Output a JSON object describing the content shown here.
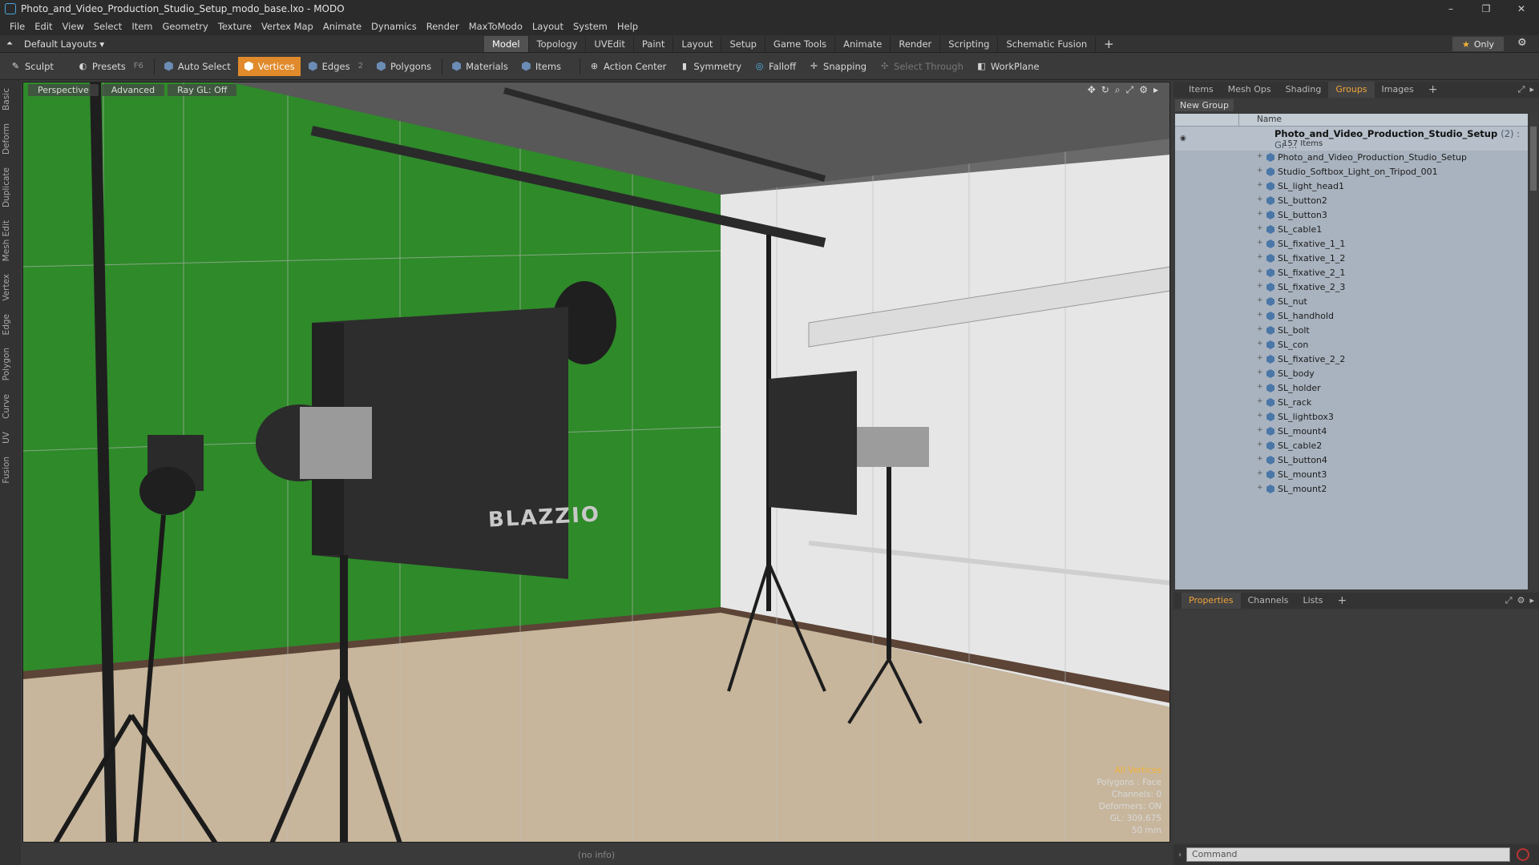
{
  "window": {
    "title": "Photo_and_Video_Production_Studio_Setup_modo_base.lxo - MODO",
    "controls": [
      "–",
      "❐",
      "✕"
    ]
  },
  "menu": [
    "File",
    "Edit",
    "View",
    "Select",
    "Item",
    "Geometry",
    "Texture",
    "Vertex Map",
    "Animate",
    "Dynamics",
    "Render",
    "MaxToModo",
    "Layout",
    "System",
    "Help"
  ],
  "layoutbar": {
    "layout_select": "Default Layouts ▾",
    "tabs": [
      "Model",
      "Topology",
      "UVEdit",
      "Paint",
      "Layout",
      "Setup",
      "Game Tools",
      "Animate",
      "Render",
      "Scripting",
      "Schematic Fusion"
    ],
    "active_tab": "Model",
    "only_label": "Only"
  },
  "toolbar": {
    "sculpt": "Sculpt",
    "presets": "Presets",
    "presets_key": "F6",
    "auto_select": "Auto Select",
    "vertices": "Vertices",
    "edges": "Edges",
    "edges_count": "2",
    "polygons": "Polygons",
    "materials": "Materials",
    "items": "Items",
    "action_center": "Action Center",
    "symmetry": "Symmetry",
    "falloff": "Falloff",
    "snapping": "Snapping",
    "select_through": "Select Through",
    "workplane": "WorkPlane"
  },
  "left_tabs": [
    "Basic",
    "Deform",
    "Duplicate",
    "Mesh Edit",
    "Vertex",
    "Edge",
    "Polygon",
    "Curve",
    "UV",
    "Fusion"
  ],
  "viewport": {
    "tabs": [
      "Perspective",
      "Advanced",
      "Ray GL: Off"
    ],
    "info": {
      "mode": "All Vertices",
      "polygons": "Polygons : Face",
      "channels": "Channels: 0",
      "deformers": "Deformers: ON",
      "gl": "GL: 309,675",
      "focal": "50 mm"
    },
    "brand_text": "BLAZZIO"
  },
  "status": {
    "text": "(no info)"
  },
  "right_panel": {
    "top_tabs": [
      "Items",
      "Mesh Ops",
      "Shading",
      "Groups",
      "Images"
    ],
    "active_top_tab": "Groups",
    "new_group": "New Group",
    "column_name": "Name",
    "root": {
      "name": "Photo_and_Video_Production_Studio_Setup",
      "count": "(2) : Gr ...",
      "sub": "157 Items"
    },
    "items": [
      "Photo_and_Video_Production_Studio_Setup",
      "Studio_Softbox_Light_on_Tripod_001",
      "SL_light_head1",
      "SL_button2",
      "SL_button3",
      "SL_cable1",
      "SL_fixative_1_1",
      "SL_fixative_1_2",
      "SL_fixative_2_1",
      "SL_fixative_2_3",
      "SL_nut",
      "SL_handhold",
      "SL_bolt",
      "SL_con",
      "SL_fixative_2_2",
      "SL_body",
      "SL_holder",
      "SL_rack",
      "SL_lightbox3",
      "SL_mount4",
      "SL_cable2",
      "SL_button4",
      "SL_mount3",
      "SL_mount2"
    ],
    "bottom_tabs": [
      "Properties",
      "Channels",
      "Lists"
    ],
    "active_bottom_tab": "Properties"
  },
  "command": {
    "placeholder": "Command"
  },
  "colors": {
    "accent": "#e08a2b",
    "tab_active": "#f0a33a",
    "green_screen": "#2f8a2a"
  }
}
